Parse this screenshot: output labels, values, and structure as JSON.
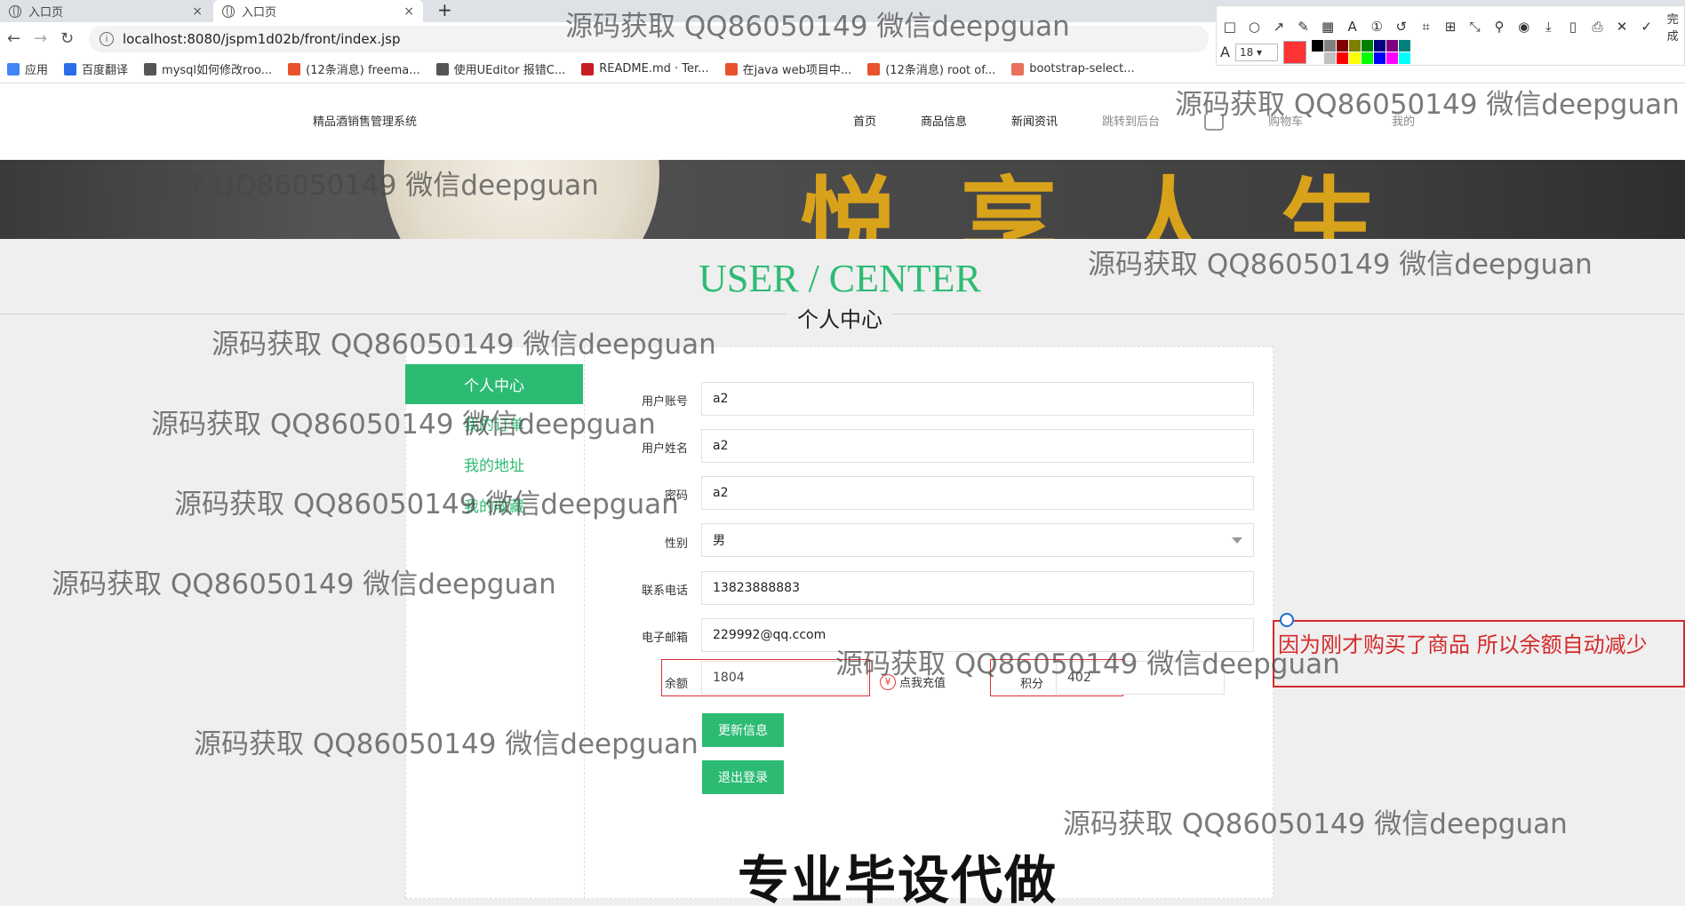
{
  "browser": {
    "tabs": [
      {
        "title": "入口页",
        "close": "×"
      },
      {
        "title": "入口页",
        "close": "×"
      }
    ],
    "new_tab": "+",
    "back": "←",
    "forward": "→",
    "reload": "↻",
    "url": "localhost:8080/jspm1d02b/front/index.jsp",
    "star": "☆",
    "menu": "⋮",
    "bookmarks": [
      {
        "label": "应用",
        "icon": "apps-icon",
        "color": "#4285f4"
      },
      {
        "label": "百度翻译",
        "icon": "baidu-translate-icon",
        "color": "#2b6de8"
      },
      {
        "label": "mysql如何修改roo...",
        "icon": "mysql-icon",
        "color": "#555555"
      },
      {
        "label": "(12条消息) freema...",
        "icon": "csdn-icon",
        "color": "#e8522d"
      },
      {
        "label": "使用UEditor 报错C...",
        "icon": "ueditor-icon",
        "color": "#555555"
      },
      {
        "label": "README.md · Ter...",
        "icon": "gitee-icon",
        "color": "#c71d23"
      },
      {
        "label": "在java web项目中...",
        "icon": "csdn-icon",
        "color": "#e8522d"
      },
      {
        "label": "(12条消息) root of...",
        "icon": "csdn-icon",
        "color": "#e8522d"
      },
      {
        "label": "bootstrap-select...",
        "icon": "jianshu-icon",
        "color": "#e9705b"
      }
    ]
  },
  "snip_toolbar": {
    "tools": [
      "□",
      "○",
      "↗",
      "✎",
      "▦",
      "A",
      "①",
      "↺",
      "⌗",
      "⊞",
      "⤡",
      "⚲",
      "◉",
      "⤓",
      "▯",
      "⎙",
      "✕",
      "✓"
    ],
    "done_label": "完成",
    "font_icon": "A",
    "font_size": "18 ▾",
    "current_color": "#ff3333",
    "palette": [
      "#000000",
      "#808080",
      "#800000",
      "#808000",
      "#008000",
      "#000080",
      "#800080",
      "#008080",
      "#ffffff",
      "#c0c0c0",
      "#ff0000",
      "#ffff00",
      "#00ff00",
      "#0000ff",
      "#ff00ff",
      "#00ffff"
    ]
  },
  "site": {
    "title": "精品酒销售管理系统",
    "nav": [
      "首页",
      "商品信息",
      "新闻资讯",
      "跳转到后台",
      "购物车",
      "我的"
    ]
  },
  "banner": {
    "text": "悦享人生"
  },
  "page": {
    "title": "USER / CENTER",
    "subtitle": "个人中心"
  },
  "sidebar": {
    "active": "个人中心",
    "items": [
      "我的订单",
      "我的地址",
      "我的收藏"
    ]
  },
  "form": {
    "account_label": "用户账号",
    "account_value": "a2",
    "name_label": "用户姓名",
    "name_value": "a2",
    "password_label": "密码",
    "password_value": "a2",
    "gender_label": "性别",
    "gender_value": "男",
    "phone_label": "联系电话",
    "phone_value": "13823888883",
    "email_label": "电子邮箱",
    "email_value": "229992@qq.ccom",
    "balance_label": "余额",
    "balance_value": "1804",
    "recharge_label": "点我充值",
    "points_label": "积分",
    "points_value": "402",
    "update_button": "更新信息",
    "logout_button": "退出登录"
  },
  "annotation": {
    "text": "因为刚才购买了商品 所以余额自动减少"
  },
  "promo": "专业毕设代做",
  "watermark": "源码获取 QQ86050149 微信deepguan"
}
